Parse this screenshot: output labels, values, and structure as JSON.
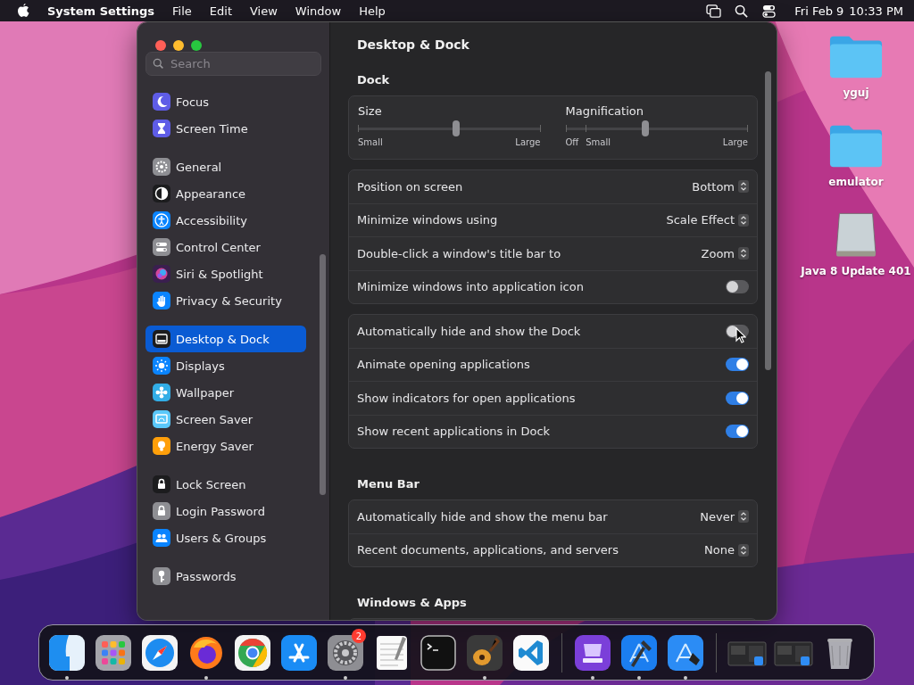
{
  "menu_bar": {
    "app_name": "System Settings",
    "menus": [
      "File",
      "Edit",
      "View",
      "Window",
      "Help"
    ],
    "date": "Fri Feb 9",
    "time": "10:33 PM"
  },
  "window": {
    "search": {
      "placeholder": "Search"
    },
    "sidebar": {
      "groups": [
        [
          {
            "label": "Focus",
            "kind": "moon",
            "color": "#5e5ce6",
            "selected": false
          },
          {
            "label": "Screen Time",
            "kind": "hourglass",
            "color": "#5e5ce6",
            "selected": false
          }
        ],
        [
          {
            "label": "General",
            "kind": "gear",
            "color": "#8e8e93",
            "selected": false
          },
          {
            "label": "Appearance",
            "kind": "contrast",
            "color": "#1c1c1e",
            "selected": false
          },
          {
            "label": "Accessibility",
            "kind": "accessibility",
            "color": "#0a84ff",
            "selected": false
          },
          {
            "label": "Control Center",
            "kind": "toggles",
            "color": "#8e8e93",
            "selected": false
          },
          {
            "label": "Siri & Spotlight",
            "kind": "orb",
            "color": "#3a1f4f",
            "selected": false
          },
          {
            "label": "Privacy & Security",
            "kind": "hand",
            "color": "#0a84ff",
            "selected": false
          }
        ],
        [
          {
            "label": "Desktop & Dock",
            "kind": "dock",
            "color": "#1c1c1e",
            "selected": true
          },
          {
            "label": "Displays",
            "kind": "sun",
            "color": "#0a84ff",
            "selected": false
          },
          {
            "label": "Wallpaper",
            "kind": "flower",
            "color": "#32ade6",
            "selected": false
          },
          {
            "label": "Screen Saver",
            "kind": "screen",
            "color": "#5ac8fa",
            "selected": false
          },
          {
            "label": "Energy Saver",
            "kind": "bulb",
            "color": "#ff9f0a",
            "selected": false
          }
        ],
        [
          {
            "label": "Lock Screen",
            "kind": "lock",
            "color": "#1c1c1e",
            "selected": false
          },
          {
            "label": "Login Password",
            "kind": "lock",
            "color": "#8e8e93",
            "selected": false
          },
          {
            "label": "Users & Groups",
            "kind": "people",
            "color": "#0a84ff",
            "selected": false
          }
        ],
        [
          {
            "label": "Passwords",
            "kind": "key",
            "color": "#8e8e93",
            "selected": false
          }
        ]
      ]
    },
    "title": "Desktop & Dock",
    "sections": [
      {
        "kind": "sliders",
        "heading": "Dock",
        "sliders": [
          {
            "label": "Size",
            "level": 0.54,
            "marks": [
              "Small",
              "Large"
            ]
          },
          {
            "label": "Magnification",
            "level": 0.44,
            "marks": [
              "Off",
              "Small",
              "Large"
            ]
          }
        ]
      },
      {
        "kind": "rows",
        "rows": [
          {
            "kind": "popup",
            "label": "Position on screen",
            "value": "Bottom"
          },
          {
            "kind": "popup",
            "label": "Minimize windows using",
            "value": "Scale Effect"
          },
          {
            "kind": "popup",
            "label": "Double-click a window's title bar to",
            "value": "Zoom"
          },
          {
            "kind": "toggle",
            "label": "Minimize windows into application icon",
            "on": false
          }
        ]
      },
      {
        "kind": "rows",
        "rows": [
          {
            "kind": "toggle",
            "label": "Automatically hide and show the Dock",
            "on": false
          },
          {
            "kind": "toggle",
            "label": "Animate opening applications",
            "on": true
          },
          {
            "kind": "toggle",
            "label": "Show indicators for open applications",
            "on": true
          },
          {
            "kind": "toggle",
            "label": "Show recent applications in Dock",
            "on": true
          }
        ]
      },
      {
        "kind": "rows",
        "heading": "Menu Bar",
        "rows": [
          {
            "kind": "popup",
            "label": "Automatically hide and show the menu bar",
            "value": "Never"
          },
          {
            "kind": "popup",
            "label": "Recent documents, applications, and servers",
            "value": "None"
          }
        ]
      },
      {
        "kind": "clipped",
        "heading": "Windows & Apps"
      }
    ]
  },
  "desktop_icons": [
    {
      "kind": "folder",
      "label": "yguj"
    },
    {
      "kind": "folder",
      "label": "emulator"
    },
    {
      "kind": "drive",
      "label": "Java 8 Update 401"
    }
  ],
  "dock": {
    "items": [
      {
        "kind": "finder",
        "running": true
      },
      {
        "kind": "launchpad",
        "running": false
      },
      {
        "kind": "safari",
        "running": false
      },
      {
        "kind": "firefox",
        "running": true
      },
      {
        "kind": "chrome",
        "running": false
      },
      {
        "kind": "appstore",
        "running": false
      },
      {
        "kind": "settings",
        "running": true,
        "badge": "2"
      },
      {
        "kind": "textedit",
        "running": false
      },
      {
        "kind": "terminal",
        "running": false
      },
      {
        "kind": "garageband",
        "running": true
      },
      {
        "kind": "vscode",
        "running": false
      },
      {
        "kind": "separator"
      },
      {
        "kind": "tray",
        "running": true
      },
      {
        "kind": "xcode",
        "running": true
      },
      {
        "kind": "blueprint",
        "running": true
      },
      {
        "kind": "separator"
      },
      {
        "kind": "thumbnail",
        "running": false
      },
      {
        "kind": "thumbnail",
        "running": false
      },
      {
        "kind": "trash",
        "running": false
      }
    ]
  }
}
